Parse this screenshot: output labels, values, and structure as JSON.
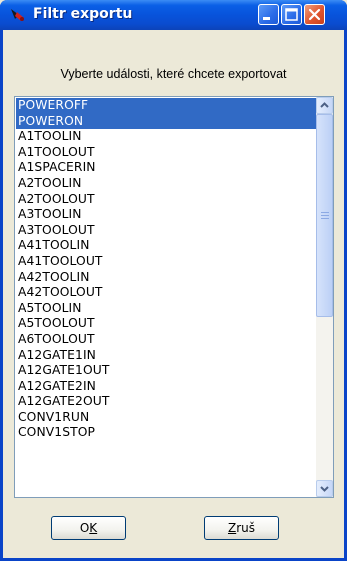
{
  "window": {
    "title": "Filtr exportu",
    "prompt": "Vyberte události, které chcete exportovat"
  },
  "events": [
    {
      "label": "POWEROFF",
      "selected": true
    },
    {
      "label": "POWERON",
      "selected": true
    },
    {
      "label": "A1TOOLIN",
      "selected": false
    },
    {
      "label": "A1TOOLOUT",
      "selected": false
    },
    {
      "label": "A1SPACERIN",
      "selected": false
    },
    {
      "label": "A2TOOLIN",
      "selected": false
    },
    {
      "label": "A2TOOLOUT",
      "selected": false
    },
    {
      "label": "A3TOOLIN",
      "selected": false
    },
    {
      "label": "A3TOOLOUT",
      "selected": false
    },
    {
      "label": "A41TOOLIN",
      "selected": false
    },
    {
      "label": "A41TOOLOUT",
      "selected": false
    },
    {
      "label": "A42TOOLIN",
      "selected": false
    },
    {
      "label": "A42TOOLOUT",
      "selected": false
    },
    {
      "label": "A5TOOLIN",
      "selected": false
    },
    {
      "label": "A5TOOLOUT",
      "selected": false
    },
    {
      "label": "A6TOOLOUT",
      "selected": false
    },
    {
      "label": "A12GATE1IN",
      "selected": false
    },
    {
      "label": "A12GATE1OUT",
      "selected": false
    },
    {
      "label": "A12GATE2IN",
      "selected": false
    },
    {
      "label": "A12GATE2OUT",
      "selected": false
    },
    {
      "label": "CONV1RUN",
      "selected": false
    },
    {
      "label": "CONV1STOP",
      "selected": false
    }
  ],
  "buttons": {
    "ok": {
      "prefix": "O",
      "mnemonic": "K",
      "suffix": ""
    },
    "cancel": {
      "prefix": "",
      "mnemonic": "Z",
      "suffix": "ruš"
    }
  },
  "colors": {
    "selection": "#316AC5",
    "titlebar": "#0853DB",
    "dialog_bg": "#ECE9D8"
  }
}
